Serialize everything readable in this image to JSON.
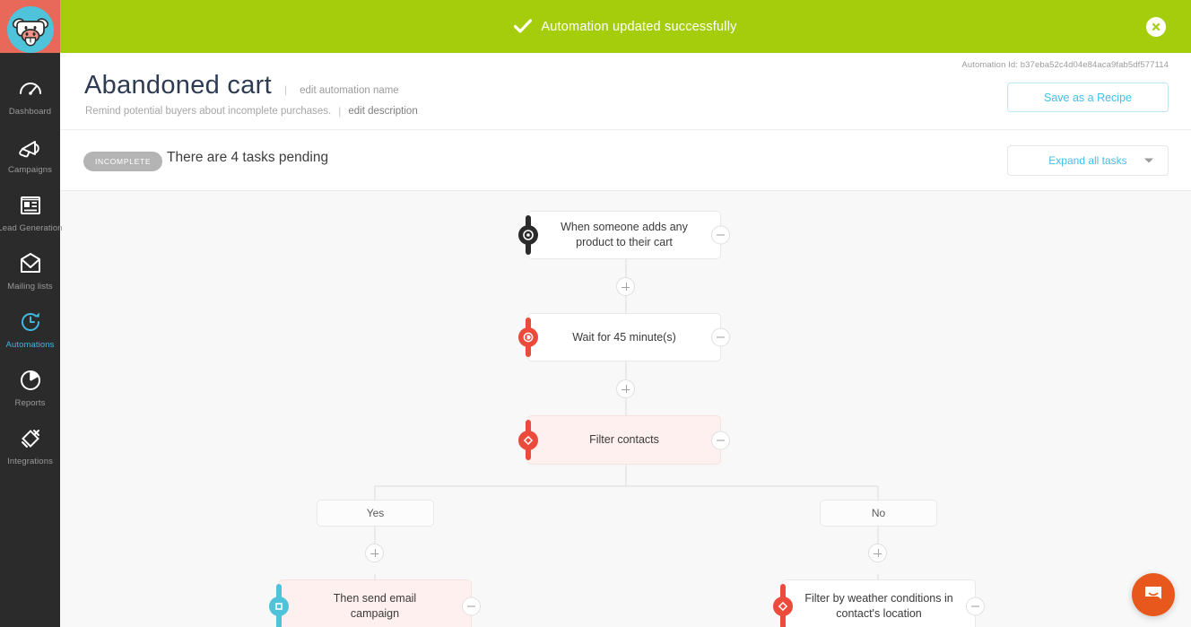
{
  "brand": {
    "logo_name": "cow-mascot-logo",
    "logo_bg": "#e8685a",
    "logo_circle": "#4ec3d9"
  },
  "banner": {
    "message": "Automation updated successfully",
    "bg_color": "#a5cd0b",
    "check_icon": "check-icon",
    "close_icon": "close-icon"
  },
  "sidebar": {
    "items": [
      {
        "label": "Dashboard",
        "icon": "speedometer-icon",
        "active": false
      },
      {
        "label": "Campaigns",
        "icon": "megaphone-icon",
        "active": false
      },
      {
        "label": "Lead Generation",
        "icon": "form-icon",
        "active": false
      },
      {
        "label": "Mailing lists",
        "icon": "envelope-icon",
        "active": false
      },
      {
        "label": "Automations",
        "icon": "clock-refresh-icon",
        "active": true
      },
      {
        "label": "Reports",
        "icon": "pie-chart-icon",
        "active": false
      },
      {
        "label": "Integrations",
        "icon": "plug-icon",
        "active": false
      }
    ]
  },
  "header": {
    "automation_id_label": "Automation Id: b37eba52c4d04e84aca9fab5df577114",
    "title": "Abandoned cart",
    "edit_name_link": "edit automation name",
    "description": "Remind potential buyers about incomplete purchases.",
    "edit_description_link": "edit description",
    "save_recipe_button": "Save as a Recipe",
    "accent_color": "#3fc0e8"
  },
  "statusbar": {
    "badge": "INCOMPLETE",
    "badge_color": "#b4b4b4",
    "tasks_text": "There are 4 tasks pending",
    "expand_button": "Expand all tasks",
    "caret_icon": "chevron-down-icon"
  },
  "flow": {
    "nodes": [
      {
        "id": "trigger",
        "text": "When someone adds any product to their cart",
        "accent": "dark",
        "icon": "target-icon",
        "filled": false
      },
      {
        "id": "wait",
        "text": "Wait for 45 minute(s)",
        "accent": "red",
        "icon": "delay-icon",
        "filled": false
      },
      {
        "id": "filter",
        "text": "Filter contacts",
        "accent": "red",
        "icon": "diamond-icon",
        "filled": true
      },
      {
        "id": "send-email",
        "text": "Then send email campaign",
        "accent": "cyan",
        "icon": "square-icon",
        "filled": true
      },
      {
        "id": "weather-filter",
        "text": "Filter by weather conditions in contact's location",
        "accent": "red",
        "icon": "diamond-icon",
        "filled": false
      }
    ],
    "branches": [
      {
        "id": "yes",
        "label": "Yes"
      },
      {
        "id": "no",
        "label": "No"
      }
    ],
    "add_icon": "plus-icon",
    "remove_icon": "minus-icon",
    "canvas_bg": "#f8f8f8"
  },
  "intercom": {
    "icon": "chat-bubble-icon",
    "color": "#e8581c"
  }
}
